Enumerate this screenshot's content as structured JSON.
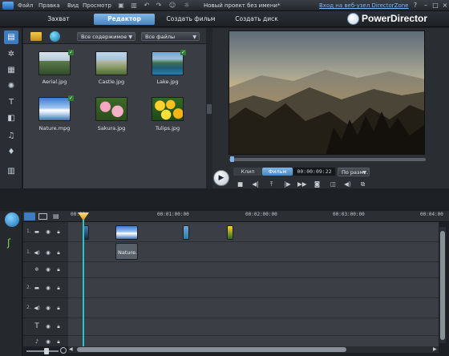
{
  "menu": [
    "Файл",
    "Правка",
    "Вид",
    "Просмотр"
  ],
  "project_title": "Новый проект без имени*",
  "directorzone_link": "Вход на веб-узел DirectorZone",
  "window_buttons": [
    "?",
    "–",
    "□",
    "×"
  ],
  "modes": [
    "Захват",
    "Редактор",
    "Создать фильм",
    "Создать диск"
  ],
  "active_mode": "Редактор",
  "brand": "PowerDirector",
  "library": {
    "filter_content": "Все содержимое",
    "filter_files": "Все файлы",
    "items": [
      {
        "label": "Aerial.jpg",
        "checked": true
      },
      {
        "label": "Castle.jpg",
        "checked": false
      },
      {
        "label": "Lake.jpg",
        "checked": true
      },
      {
        "label": "Nature.mpg",
        "checked": true
      },
      {
        "label": "Sakura.jpg",
        "checked": false
      },
      {
        "label": "Tulips.jpg",
        "checked": false
      }
    ]
  },
  "preview": {
    "tab_clip": "Клип",
    "tab_movie": "Фильм",
    "active_tab": "Фильм",
    "timecode": "00:00:09:22",
    "scale": "По разм..."
  },
  "timeline": {
    "ruler": [
      "00:00",
      "00:01:00:00",
      "00:02:00:00",
      "00:03:00:00",
      "00:04:00"
    ],
    "track_numbers": [
      "1.",
      "1.",
      "2.",
      "2."
    ],
    "clip_label": "Nature."
  },
  "colors": {
    "accent": "#4a86c0",
    "playhead": "#22c7c7",
    "link": "#7fb7ff"
  }
}
